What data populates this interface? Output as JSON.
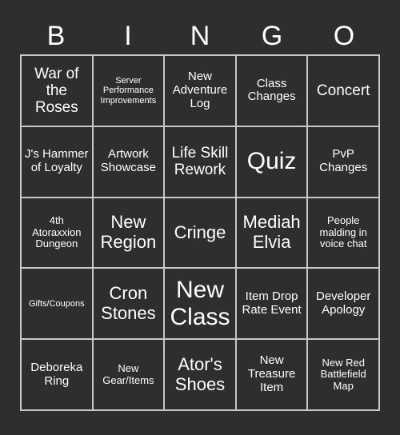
{
  "header": {
    "letters": [
      "B",
      "I",
      "N",
      "G",
      "O"
    ]
  },
  "colors": {
    "background": "#2e2e2e",
    "cell_background": "#2e2e2e",
    "grid_line": "#c8c8c8",
    "text": "#ffffff"
  },
  "grid": {
    "columns": 5,
    "rows": 5,
    "cells": [
      {
        "text": "War of the Roses",
        "size": "lg"
      },
      {
        "text": "Server Performance Improvements",
        "size": "xs"
      },
      {
        "text": "New Adventure Log",
        "size": "md"
      },
      {
        "text": "Class Changes",
        "size": "md"
      },
      {
        "text": "Concert",
        "size": "lg"
      },
      {
        "text": "J's Hammer of Loyalty",
        "size": "md"
      },
      {
        "text": "Artwork Showcase",
        "size": "md"
      },
      {
        "text": "Life Skill Rework",
        "size": "lg"
      },
      {
        "text": "Quiz",
        "size": "xxl"
      },
      {
        "text": "PvP Changes",
        "size": "md"
      },
      {
        "text": "4th Atoraxxion Dungeon",
        "size": "sm"
      },
      {
        "text": "New Region",
        "size": "xl"
      },
      {
        "text": "Cringe",
        "size": "xl"
      },
      {
        "text": "Mediah Elvia",
        "size": "xl"
      },
      {
        "text": "People malding in voice chat",
        "size": "sm"
      },
      {
        "text": "Gifts/Coupons",
        "size": "xs"
      },
      {
        "text": "Cron Stones",
        "size": "xl"
      },
      {
        "text": "New Class",
        "size": "xxl"
      },
      {
        "text": "Item Drop Rate Event",
        "size": "md"
      },
      {
        "text": "Developer Apology",
        "size": "md"
      },
      {
        "text": "Deboreka Ring",
        "size": "md"
      },
      {
        "text": "New Gear/Items",
        "size": "sm"
      },
      {
        "text": "Ator's Shoes",
        "size": "xl"
      },
      {
        "text": "New Treasure Item",
        "size": "md"
      },
      {
        "text": "New Red Battlefield Map",
        "size": "sm"
      }
    ]
  }
}
